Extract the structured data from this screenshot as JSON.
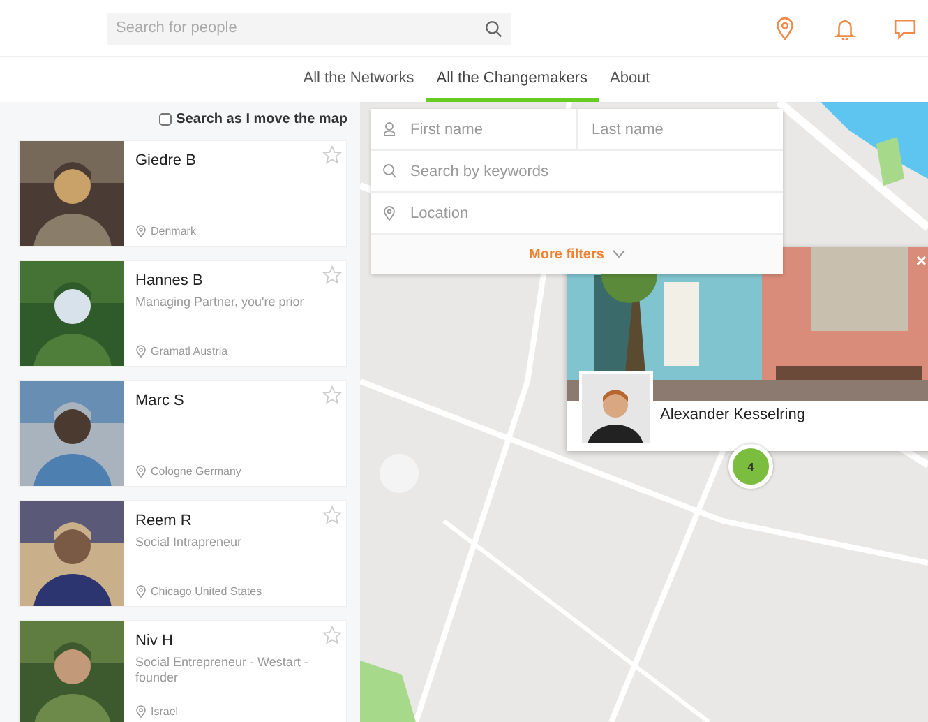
{
  "header": {
    "search": {
      "placeholder": "Search for people"
    }
  },
  "tabs": [
    {
      "label": "All the Networks",
      "selected": false
    },
    {
      "label": "All the Changemakers",
      "selected": true
    },
    {
      "label": "About",
      "selected": false
    }
  ],
  "sidebar": {
    "map_search": {
      "label": "Search as I move the map",
      "checked": false
    },
    "people": [
      {
        "name": "Giedre B",
        "location": "Denmark"
      },
      {
        "name": "Hannes B",
        "title": "Managing Partner, you're prior",
        "location": "Gramatl Austria"
      },
      {
        "name": "Marc S",
        "location": "Cologne Germany"
      },
      {
        "name": "Reem R",
        "title": "Social Intrapreneur",
        "location": "Chicago United States"
      },
      {
        "name": "Niv H",
        "title": "Social Entrepreneur - Westart - founder",
        "location": "Israel"
      }
    ]
  },
  "filters": {
    "first_name": {
      "placeholder": "First name"
    },
    "last_name": {
      "placeholder": "Last name"
    },
    "keywords": {
      "placeholder": "Search by keywords"
    },
    "location": {
      "placeholder": "Location"
    },
    "more": "More filters"
  },
  "popup": {
    "name": "Alexander Kesselring",
    "close": "×"
  },
  "cluster": {
    "count": "4"
  }
}
